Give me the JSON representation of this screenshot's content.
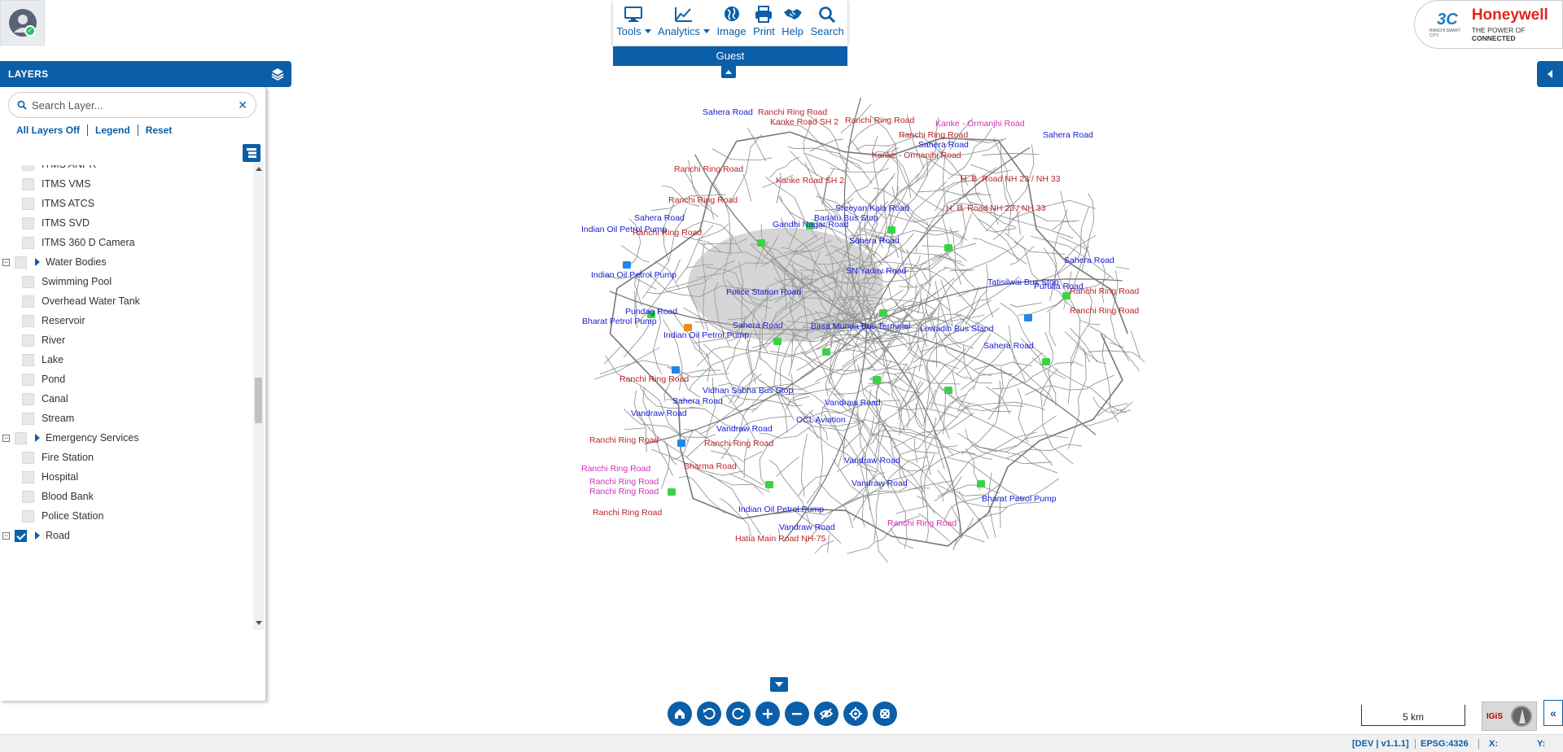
{
  "layers": {
    "title": "LAYERS",
    "search_placeholder": "Search Layer...",
    "links": [
      "All Layers Off",
      "Legend",
      "Reset"
    ],
    "items": [
      {
        "label": "ITMS ANPR",
        "level": 1,
        "checked": false
      },
      {
        "label": "ITMS VMS",
        "level": 1,
        "checked": false
      },
      {
        "label": "ITMS ATCS",
        "level": 1,
        "checked": false
      },
      {
        "label": "ITMS SVD",
        "level": 1,
        "checked": false
      },
      {
        "label": "ITMS 360 D Camera",
        "level": 1,
        "checked": false
      },
      {
        "label": "Water Bodies",
        "level": 0,
        "checked": false
      },
      {
        "label": "Swimming Pool",
        "level": 1,
        "checked": false
      },
      {
        "label": "Overhead Water Tank",
        "level": 1,
        "checked": false
      },
      {
        "label": "Reservoir",
        "level": 1,
        "checked": false
      },
      {
        "label": "River",
        "level": 1,
        "checked": false
      },
      {
        "label": "Lake",
        "level": 1,
        "checked": false
      },
      {
        "label": "Pond",
        "level": 1,
        "checked": false
      },
      {
        "label": "Canal",
        "level": 1,
        "checked": false
      },
      {
        "label": "Stream",
        "level": 1,
        "checked": false
      },
      {
        "label": "Emergency Services",
        "level": 0,
        "checked": false
      },
      {
        "label": "Fire Station",
        "level": 1,
        "checked": false
      },
      {
        "label": "Hospital",
        "level": 1,
        "checked": false
      },
      {
        "label": "Blood Bank",
        "level": 1,
        "checked": false
      },
      {
        "label": "Police Station",
        "level": 1,
        "checked": false
      },
      {
        "label": "Road",
        "level": 0,
        "checked": true
      }
    ]
  },
  "toolbar": {
    "tools": [
      {
        "label": "Tools",
        "icon": "monitor-icon",
        "dropdown": true
      },
      {
        "label": "Analytics",
        "icon": "line-chart-icon",
        "dropdown": true
      },
      {
        "label": "Image",
        "icon": "globe-icon",
        "dropdown": false
      },
      {
        "label": "Print",
        "icon": "printer-icon",
        "dropdown": false
      },
      {
        "label": "Help",
        "icon": "handshake-icon",
        "dropdown": false
      },
      {
        "label": "Search",
        "icon": "search-icon",
        "dropdown": false
      }
    ],
    "user_role": "Guest"
  },
  "logo": {
    "partner_mark": "3C",
    "partner_text": "RANCHI SMART CITY",
    "brand": "Honeywell",
    "tagline_plain": "THE POWER OF ",
    "tagline_bold": "CONNECTED"
  },
  "map": {
    "labels": [
      {
        "text": "Sahera Road",
        "color": "blue"
      },
      {
        "text": "Ranchi Ring Road",
        "color": "red"
      },
      {
        "text": "Kanke Road SH 2",
        "color": "red"
      },
      {
        "text": "Ranchi Ring Road",
        "color": "red"
      },
      {
        "text": "Kanke - Ormanjhi Road",
        "color": "pink"
      },
      {
        "text": "Ranchi Ring Road",
        "color": "red"
      },
      {
        "text": "Sahera Road",
        "color": "blue"
      },
      {
        "text": "Sahera Road",
        "color": "blue"
      },
      {
        "text": "Kanke - Ormanjhi Road",
        "color": "red"
      },
      {
        "text": "Ranchi Ring Road",
        "color": "red"
      },
      {
        "text": "Kanke Road SH 2",
        "color": "red"
      },
      {
        "text": "H. B. Road NH 23 / NH 33",
        "color": "red"
      },
      {
        "text": "Ranchi Ring Road",
        "color": "red"
      },
      {
        "text": "Sreeyan Kala Road",
        "color": "blue"
      },
      {
        "text": "Bariatu Bus Stop",
        "color": "blue"
      },
      {
        "text": "H. B. Road NH 23 / NH 33",
        "color": "red"
      },
      {
        "text": "Sahera Road",
        "color": "blue"
      },
      {
        "text": "Gandhi Nagar Road",
        "color": "blue"
      },
      {
        "text": "Ranchi Ring Road",
        "color": "red"
      },
      {
        "text": "Indian Oil Petrol Pump",
        "color": "blue"
      },
      {
        "text": "Sahera Road",
        "color": "blue"
      },
      {
        "text": "SN Yadav Road",
        "color": "blue"
      },
      {
        "text": "Indian Oil Petrol Pump",
        "color": "blue"
      },
      {
        "text": "Tatisilwai Bus Stop",
        "color": "blue"
      },
      {
        "text": "Sahera Road",
        "color": "blue"
      },
      {
        "text": "Police Station Road",
        "color": "blue"
      },
      {
        "text": "Ranchi Ring Road",
        "color": "red"
      },
      {
        "text": "Purulia Road",
        "color": "blue"
      },
      {
        "text": "Pundag Road",
        "color": "blue"
      },
      {
        "text": "Bharat Petrol Pump",
        "color": "blue"
      },
      {
        "text": "Sahera Road",
        "color": "blue"
      },
      {
        "text": "Birsa Munda Bus Terminal",
        "color": "blue"
      },
      {
        "text": "Lowadih Bus Stand",
        "color": "blue"
      },
      {
        "text": "Ranchi Ring Road",
        "color": "red"
      },
      {
        "text": "Indian Oil Petrol Pump",
        "color": "blue"
      },
      {
        "text": "Sahera Road",
        "color": "blue"
      },
      {
        "text": "Ranchi Ring Road",
        "color": "red"
      },
      {
        "text": "Vidhan Sabha Bus Stop",
        "color": "blue"
      },
      {
        "text": "Sahera Road",
        "color": "blue"
      },
      {
        "text": "Vandraw Road",
        "color": "blue"
      },
      {
        "text": "Vandraw Road",
        "color": "blue"
      },
      {
        "text": "Vandraw Road",
        "color": "blue"
      },
      {
        "text": "OCL Aviation",
        "color": "blue"
      },
      {
        "text": "Ranchi Ring Road",
        "color": "red"
      },
      {
        "text": "Ranchi Ring Road",
        "color": "red"
      },
      {
        "text": "Sharma Road",
        "color": "red"
      },
      {
        "text": "Vandraw Road",
        "color": "blue"
      },
      {
        "text": "Ranchi Ring Road",
        "color": "pink"
      },
      {
        "text": "Bharat Petrol Pump",
        "color": "blue"
      },
      {
        "text": "Ranchi Ring Road",
        "color": "pink"
      },
      {
        "text": "Vandraw Road",
        "color": "blue"
      },
      {
        "text": "Ranchi Ring Road",
        "color": "pink"
      },
      {
        "text": "Ranchi Ring Road",
        "color": "red"
      },
      {
        "text": "Indian Oil Petrol Pump",
        "color": "blue"
      },
      {
        "text": "Ranchi Ring Road",
        "color": "pink"
      },
      {
        "text": "Vandraw Road",
        "color": "blue"
      },
      {
        "text": "Hatia Main Road NH-75",
        "color": "red"
      }
    ]
  },
  "map_controls": [
    "home-icon",
    "undo-icon",
    "redo-icon",
    "zoom-in-icon",
    "zoom-out-icon",
    "hide-icon",
    "locate-icon",
    "clear-icon"
  ],
  "scale_label": "5 km",
  "mini_logo": "IGiS",
  "status": {
    "version": "[DEV | v1.1.1]",
    "epsg": "EPSG:4326",
    "x_label": "X:",
    "y_label": "Y:"
  },
  "colors": {
    "accent": "#0b5ea8",
    "label_blue": "#1a1ad6",
    "label_red": "#b8262c",
    "label_pink": "#d42fb8",
    "brand_red": "#e1251b"
  }
}
